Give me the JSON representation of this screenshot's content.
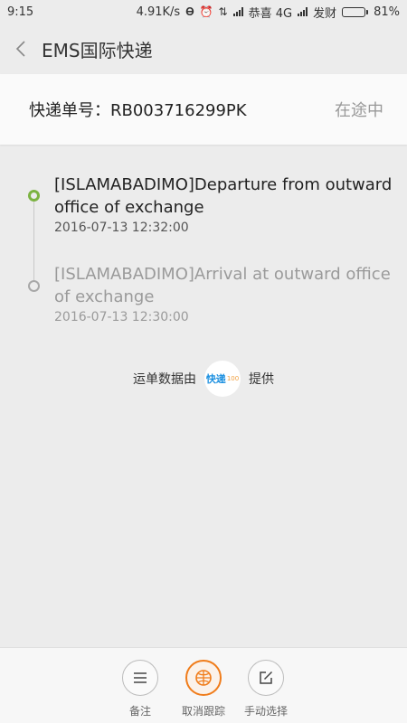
{
  "status_bar": {
    "time": "9:15",
    "net_speed": "4.91K/s",
    "carrier1": "恭喜 4G",
    "carrier2": "发财",
    "battery": "81%",
    "battery_level": 0.81
  },
  "header": {
    "back_icon": "chevron-left-icon",
    "title": "EMS国际快递"
  },
  "summary": {
    "tracking_label": "快递单号：RB003716299PK",
    "status": "在途中"
  },
  "events": [
    {
      "desc": "[ISLAMABADIMO]Departure from outward office of exchange",
      "time": "2016-07-13 12:32:00",
      "latest": true
    },
    {
      "desc": "[ISLAMABADIMO]Arrival at outward office of exchange",
      "time": "2016-07-13 12:30:00",
      "latest": false
    }
  ],
  "provider": {
    "prefix": "运单数据由",
    "logo_text": "快递",
    "logo_sub": "100",
    "suffix": "提供"
  },
  "bottom_bar": {
    "remark_label": "备注",
    "cancel_label": "取消跟踪",
    "manual_label": "手动选择"
  },
  "colors": {
    "accent_green": "#7cb342",
    "accent_orange": "#f07c1a",
    "latest_text": "#222222",
    "old_text": "#9a9a9a"
  }
}
